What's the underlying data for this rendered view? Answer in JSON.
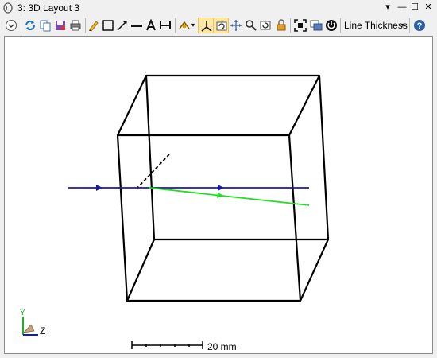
{
  "window": {
    "title": "3: 3D Layout 3",
    "controls": {
      "pin": "▾",
      "minimize": "—",
      "maximize": "☐",
      "close": "✕"
    }
  },
  "toolbar": {
    "line_thickness_label": "Line Thickness",
    "line_thickness_arrow": "▾",
    "buttons": [
      "settings-dropdown",
      "refresh",
      "copy",
      "save",
      "print",
      "pencil",
      "rectangle",
      "arrow",
      "line",
      "text",
      "dimension",
      "rotate",
      "axes",
      "reset-view",
      "pan",
      "zoom",
      "zoom-extents",
      "lock",
      "fit",
      "window-layout",
      "power",
      "help"
    ]
  },
  "viewport": {
    "scale_bar_label": "20 mm",
    "axis_labels": {
      "y": "Y",
      "z": "Z"
    },
    "colors": {
      "box": "#000000",
      "incident_ray": "#1a1aaa",
      "refracted_ray": "#22dd22",
      "normal_line": "#000000",
      "axis_y": "#1db31d",
      "axis_z": "#1a1aaa"
    }
  }
}
